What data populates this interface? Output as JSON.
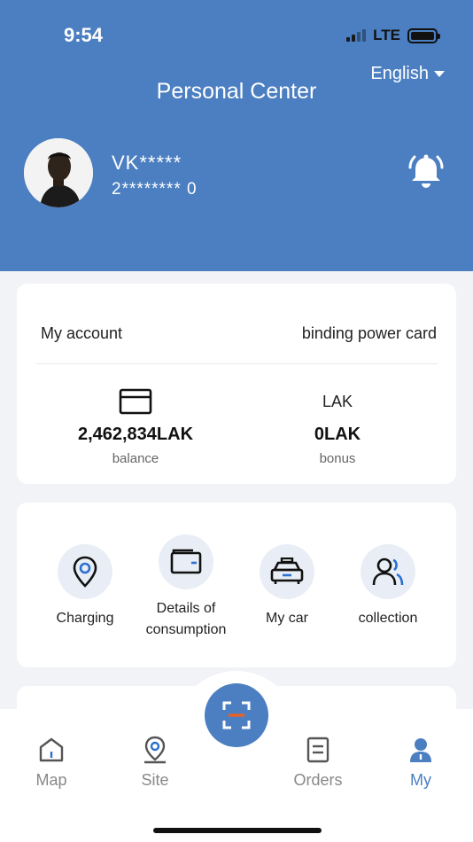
{
  "status_bar": {
    "time": "9:54",
    "network": "LTE"
  },
  "header": {
    "title": "Personal Center",
    "language": "English",
    "user_name": "VK*****",
    "user_phone": "2******** 0"
  },
  "account": {
    "my_account_label": "My account",
    "binding_label": "binding power card",
    "balance_value": "2,462,834LAK",
    "balance_label": "balance",
    "bonus_currency": "LAK",
    "bonus_value": "0LAK",
    "bonus_label": "bonus"
  },
  "menu": {
    "items": [
      {
        "label": "Charging",
        "icon": "location-pin-icon"
      },
      {
        "label": "Details of consumption",
        "icon": "wallet-icon"
      },
      {
        "label": "My car",
        "icon": "car-icon"
      },
      {
        "label": "collection",
        "icon": "users-icon"
      }
    ]
  },
  "tabbar": {
    "tabs": [
      {
        "label": "Map",
        "icon": "home-icon",
        "active": false
      },
      {
        "label": "Site",
        "icon": "site-pin-icon",
        "active": false
      },
      {
        "label": "Orders",
        "icon": "document-icon",
        "active": false
      },
      {
        "label": "My",
        "icon": "person-icon",
        "active": true
      }
    ],
    "center_action": "scan-icon"
  },
  "colors": {
    "primary": "#4b7fc1",
    "scan_accent": "#e8622c",
    "background": "#f2f3f7"
  }
}
